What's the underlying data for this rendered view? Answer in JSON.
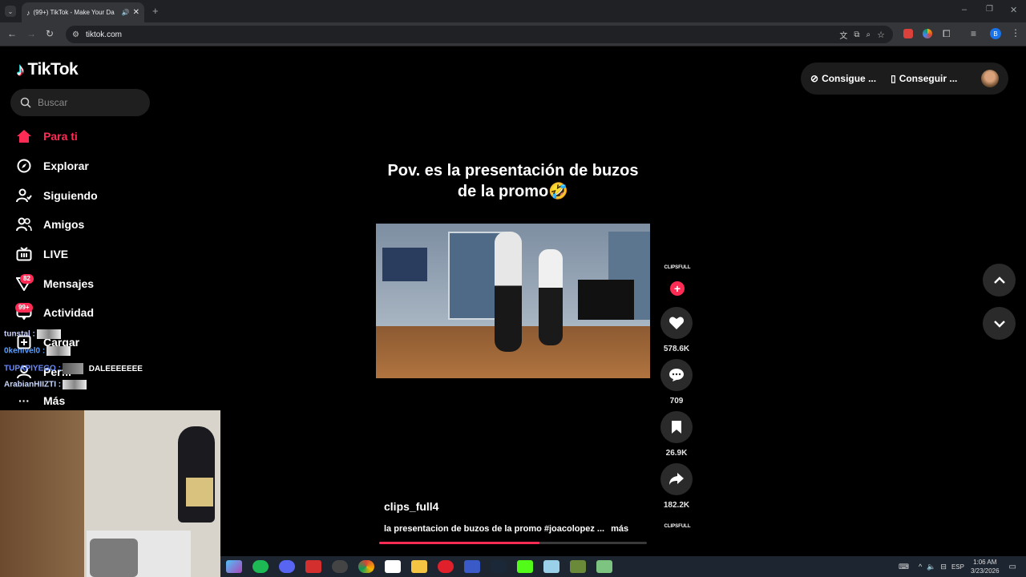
{
  "browser": {
    "tab_title": "(99+) TikTok - Make Your Da",
    "url": "tiktok.com",
    "new_tab": "+",
    "profile_initial": "B"
  },
  "sidebar": {
    "logo": "TikTok",
    "search_placeholder": "Buscar",
    "items": [
      {
        "label": "Para ti",
        "icon": "home-icon"
      },
      {
        "label": "Explorar",
        "icon": "compass-icon"
      },
      {
        "label": "Siguiendo",
        "icon": "following-icon"
      },
      {
        "label": "Amigos",
        "icon": "friends-icon"
      },
      {
        "label": "LIVE",
        "icon": "live-icon"
      },
      {
        "label": "Mensajes",
        "icon": "messages-icon"
      },
      {
        "label": "Actividad",
        "icon": "activity-icon"
      },
      {
        "label": "Cargar",
        "icon": "upload-icon"
      },
      {
        "label": "Perfil",
        "icon": "profile-icon"
      },
      {
        "label": "Más",
        "icon": "more-icon"
      }
    ],
    "messages_badge": "82",
    "activity_badge": "99+"
  },
  "chat": [
    {
      "user": "tunstal :",
      "msg": "",
      "color": "#c8d0ff"
    },
    {
      "user": "0kenivel0 :",
      "msg": "",
      "color": "#5aa0ff"
    },
    {
      "user": "TUPAPIYEGO :",
      "msg": "DALEEEEEEE",
      "color": "#6a8cff"
    },
    {
      "user": "ArabianHIIZTI :",
      "msg": "",
      "color": "#c8d8ff"
    }
  ],
  "header": {
    "btn1": "Consigue ...",
    "btn2": "Conseguir ..."
  },
  "video": {
    "caption": "Pov. es la presentación de buzos de la promo🤣",
    "author": "clips_full4",
    "description": "la presentacion de buzos de la promo #joacolopez ...",
    "more": "más",
    "progress": 0.6,
    "creator_tag": "CLIPSFULL",
    "likes": "578.6K",
    "comments": "709",
    "saves": "26.9K",
    "shares": "182.2K"
  },
  "taskbar": {
    "lang": "ESP",
    "time": "1:06 AM",
    "date": "3/23/2026"
  },
  "colors": {
    "accent": "#fe2c55",
    "taskbar": "#1c2530"
  }
}
